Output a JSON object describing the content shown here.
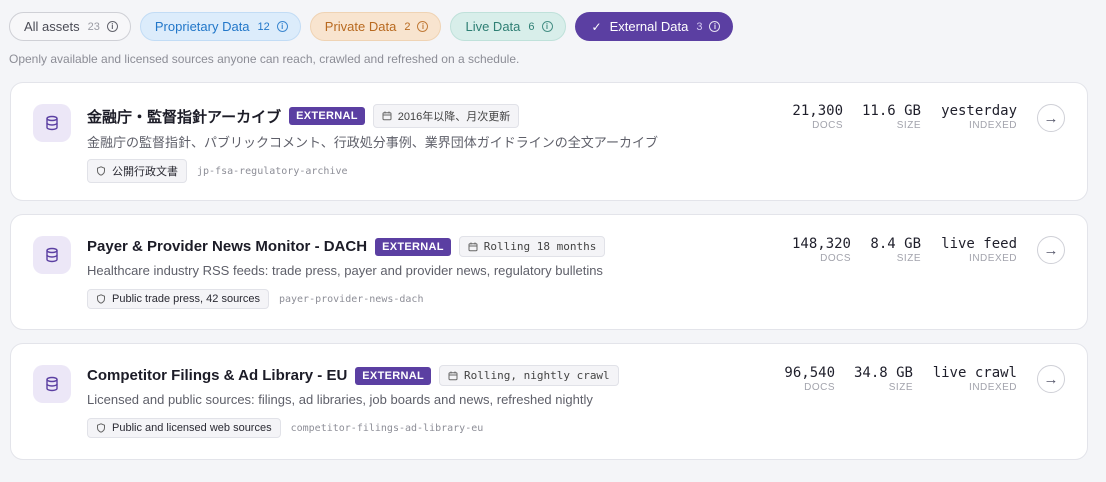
{
  "filters": [
    {
      "label": "All assets",
      "count": "23"
    },
    {
      "label": "Proprietary Data",
      "count": "12"
    },
    {
      "label": "Private Data",
      "count": "2"
    },
    {
      "label": "Live Data",
      "count": "6"
    },
    {
      "label": "External Data",
      "count": "3"
    }
  ],
  "subtitle": "Openly available and licensed sources anyone can reach, crawled and refreshed on a schedule.",
  "cards": [
    {
      "title": "金融庁・監督指針アーカイブ",
      "badge": "EXTERNAL",
      "schedule": "2016年以降、月次更新",
      "description": "金融庁の監督指針、パブリックコメント、行政処分事例、業界団体ガイドラインの全文アーカイブ",
      "source": "公開行政文書",
      "slug": "jp-fsa-regulatory-archive",
      "docs": "21,300",
      "docs_label": "DOCS",
      "size": "11.6 GB",
      "size_label": "SIZE",
      "indexed": "yesterday",
      "indexed_label": "INDEXED"
    },
    {
      "title": "Payer & Provider News Monitor - DACH",
      "badge": "EXTERNAL",
      "schedule": "Rolling 18 months",
      "description": "Healthcare industry RSS feeds: trade press, payer and provider news, regulatory bulletins",
      "source": "Public trade press, 42 sources",
      "slug": "payer-provider-news-dach",
      "docs": "148,320",
      "docs_label": "DOCS",
      "size": "8.4 GB",
      "size_label": "SIZE",
      "indexed": "live feed",
      "indexed_label": "INDEXED"
    },
    {
      "title": "Competitor Filings & Ad Library - EU",
      "badge": "EXTERNAL",
      "schedule": "Rolling, nightly crawl",
      "description": "Licensed and public sources: filings, ad libraries, job boards and news, refreshed nightly",
      "source": "Public and licensed web sources",
      "slug": "competitor-filings-ad-library-eu",
      "docs": "96,540",
      "docs_label": "DOCS",
      "size": "34.8 GB",
      "size_label": "SIZE",
      "indexed": "live crawl",
      "indexed_label": "INDEXED"
    }
  ],
  "icons": {
    "check": "check-icon",
    "info": "info-icon",
    "database": "database-icon",
    "calendar": "calendar-icon",
    "shield": "shield-icon",
    "arrow": "arrow-right-icon"
  },
  "colors": {
    "accent": "#5b3fa2",
    "proprietary": "#2277c9",
    "private": "#b8691f",
    "live": "#2e7f74"
  }
}
